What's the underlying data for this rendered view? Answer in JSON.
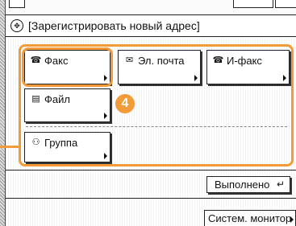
{
  "window": {
    "title": "[Зарегистрировать новый адрес]"
  },
  "buttons": {
    "fax": "Факс",
    "email": "Эл. почта",
    "ifax": "И-факс",
    "file": "Файл",
    "group": "Группа"
  },
  "callout": {
    "number": "4",
    "color": "#f29b38"
  },
  "footer": {
    "done": "Выполнено",
    "monitor": "Систем. монитор"
  },
  "icons": {
    "title": "address-book-icon",
    "fax": "fax-icon",
    "email": "email-icon",
    "ifax": "ifax-icon",
    "file": "file-icon",
    "group": "group-icon",
    "done": "enter-arrow-icon"
  }
}
